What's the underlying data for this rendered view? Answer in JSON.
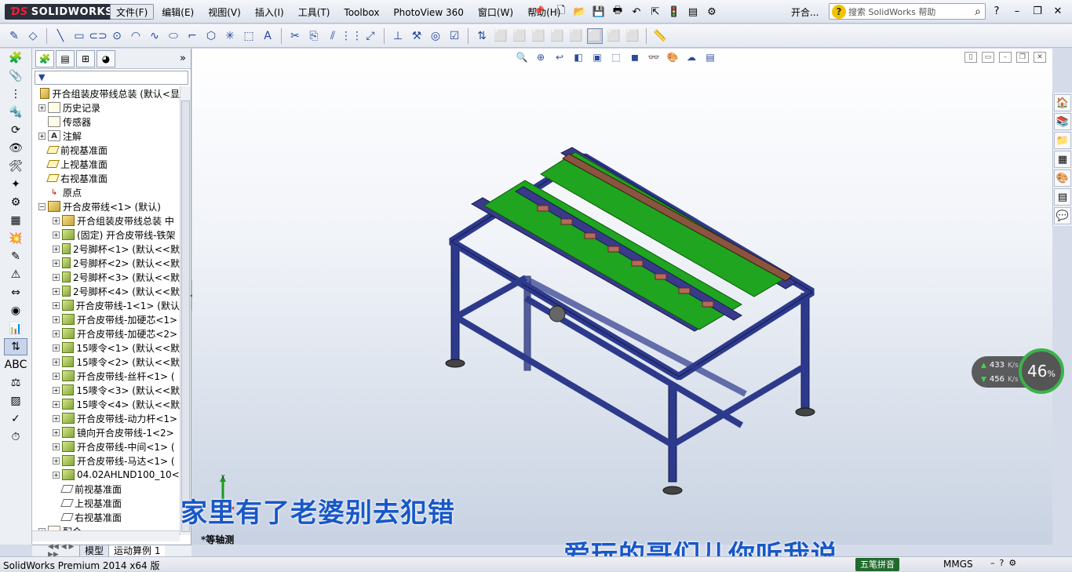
{
  "app": {
    "logo": "SOLIDWORKS",
    "menus": [
      "文件(F)",
      "编辑(E)",
      "视图(V)",
      "插入(I)",
      "工具(T)",
      "Toolbox",
      "PhotoView 360",
      "窗口(W)",
      "帮助(H)"
    ],
    "doc_title": "开合...",
    "search_placeholder": "搜索 SolidWorks 帮助"
  },
  "feature_manager": {
    "filter_symbol": "▼",
    "root": "开合组装皮带线总装 (默认<显",
    "nodes": [
      {
        "label": "历史记录",
        "icon": "hist",
        "level": 1,
        "exp": "+"
      },
      {
        "label": "传感器",
        "icon": "hist",
        "level": 1,
        "exp": ""
      },
      {
        "label": "注解",
        "icon": "ann",
        "level": 1,
        "exp": "+"
      },
      {
        "label": "前视基准面",
        "icon": "planeY",
        "level": 1,
        "exp": ""
      },
      {
        "label": "上视基准面",
        "icon": "planeY",
        "level": 1,
        "exp": ""
      },
      {
        "label": "右视基准面",
        "icon": "planeY",
        "level": 1,
        "exp": ""
      },
      {
        "label": "原点",
        "icon": "origin",
        "level": 1,
        "exp": ""
      },
      {
        "label": "开合皮带线<1> (默认)",
        "icon": "asm",
        "level": 1,
        "exp": "−"
      },
      {
        "label": "开合组装皮带线总装 中",
        "icon": "asm",
        "level": 2,
        "exp": "+"
      },
      {
        "label": "(固定) 开合皮带线-铁架",
        "icon": "part",
        "level": 2,
        "exp": "+"
      },
      {
        "label": "2号脚杯<1> (默认<<默",
        "icon": "part",
        "level": 2,
        "exp": "+"
      },
      {
        "label": "2号脚杯<2> (默认<<默",
        "icon": "part",
        "level": 2,
        "exp": "+"
      },
      {
        "label": "2号脚杯<3> (默认<<默",
        "icon": "part",
        "level": 2,
        "exp": "+"
      },
      {
        "label": "2号脚杯<4> (默认<<默",
        "icon": "part",
        "level": 2,
        "exp": "+"
      },
      {
        "label": "开合皮带线-1<1> (默认",
        "icon": "part",
        "level": 2,
        "exp": "+"
      },
      {
        "label": "开合皮带线-加硬芯<1>",
        "icon": "part",
        "level": 2,
        "exp": "+"
      },
      {
        "label": "开合皮带线-加硬芯<2>",
        "icon": "part",
        "level": 2,
        "exp": "+"
      },
      {
        "label": "15嘜令<1> (默认<<默",
        "icon": "part",
        "level": 2,
        "exp": "+"
      },
      {
        "label": "15嘜令<2> (默认<<默",
        "icon": "part",
        "level": 2,
        "exp": "+"
      },
      {
        "label": "开合皮带线-丝杆<1> (",
        "icon": "part",
        "level": 2,
        "exp": "+"
      },
      {
        "label": "15嘜令<3> (默认<<默",
        "icon": "part",
        "level": 2,
        "exp": "+"
      },
      {
        "label": "15嘜令<4> (默认<<默",
        "icon": "part",
        "level": 2,
        "exp": "+"
      },
      {
        "label": "开合皮带线-动力杆<1>",
        "icon": "part",
        "level": 2,
        "exp": "+"
      },
      {
        "label": "镜向开合皮带线-1<2>",
        "icon": "part",
        "level": 2,
        "exp": "+"
      },
      {
        "label": "开合皮带线-中间<1> (",
        "icon": "part",
        "level": 2,
        "exp": "+"
      },
      {
        "label": "开合皮带线-马达<1> (",
        "icon": "part",
        "level": 2,
        "exp": "+"
      },
      {
        "label": "04.02AHLND100_10<",
        "icon": "part",
        "level": 2,
        "exp": "+"
      },
      {
        "label": "前视基准面",
        "icon": "plane",
        "level": 2,
        "exp": ""
      },
      {
        "label": "上视基准面",
        "icon": "plane",
        "level": 2,
        "exp": ""
      },
      {
        "label": "右视基准面",
        "icon": "plane",
        "level": 2,
        "exp": ""
      },
      {
        "label": "配合",
        "icon": "hist",
        "level": 1,
        "exp": "+"
      }
    ],
    "bottom_tabs": [
      "模型",
      "运动算例 1"
    ]
  },
  "viewport": {
    "view_label": "*等轴测",
    "triad_axis_label": "Y"
  },
  "network": {
    "upload": "433",
    "download": "456",
    "unit": "K/s",
    "percent": "46",
    "percent_sign": "%"
  },
  "subtitles": {
    "line1": "家里有了老婆别去犯错",
    "line2": "爱玩的哥们儿你听我说"
  },
  "statusbar": {
    "app_version": "SolidWorks Premium 2014 x64 版",
    "ime": "五笔拼音",
    "units": "MMGS"
  },
  "colors": {
    "frame": "#2d3a8c",
    "belt": "#1fa51f",
    "roller": "#b8695a",
    "subtitle": "#1858c8"
  }
}
